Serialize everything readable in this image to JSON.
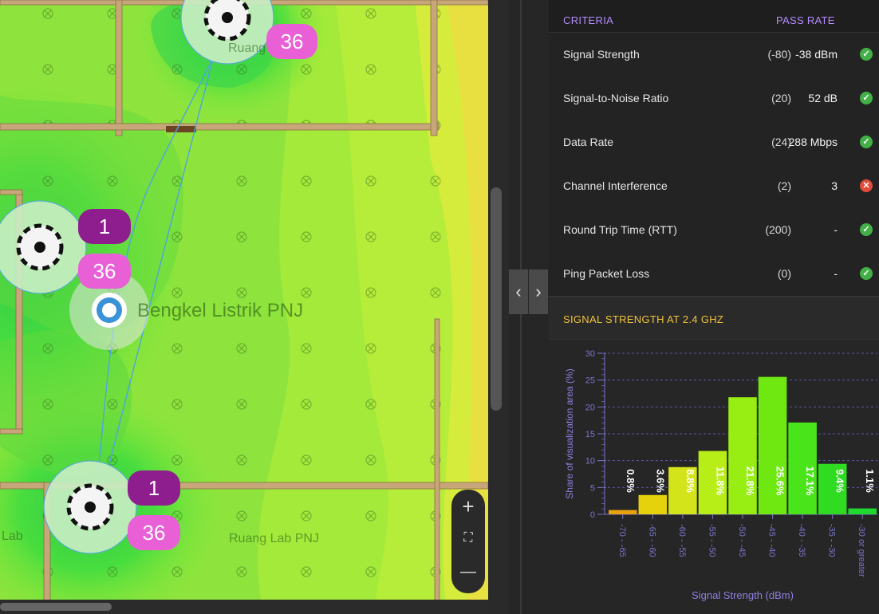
{
  "map": {
    "room_labels": [
      "Ruang Kelas",
      "Bengkel Listrik PNJ",
      "Lab",
      "Ruang Lab PNJ"
    ],
    "access_points": [
      {
        "channel_top": "1",
        "channel_bottom": "36"
      },
      {
        "channel_top": "1",
        "channel_bottom": "36"
      },
      {
        "channel_top": "",
        "channel_bottom": "36"
      }
    ],
    "zoom": {
      "in": "+",
      "fit": "⛶",
      "out": "—"
    }
  },
  "nav": {
    "collapse_left": "‹",
    "expand_right": "›"
  },
  "criteria": {
    "header_label": "CRITERIA",
    "header_pass": "PASS RATE",
    "rows": [
      {
        "label": "Signal Strength",
        "threshold": "(-80)",
        "value": "-38 dBm",
        "status": "pass"
      },
      {
        "label": "Signal-to-Noise Ratio",
        "threshold": "(20)",
        "value": "52 dB",
        "status": "pass"
      },
      {
        "label": "Data Rate",
        "threshold": "(24)",
        "value": "288 Mbps",
        "status": "pass"
      },
      {
        "label": "Channel Interference",
        "threshold": "(2)",
        "value": "3",
        "status": "fail"
      },
      {
        "label": "Round Trip Time (RTT)",
        "threshold": "(200)",
        "value": "-",
        "status": "pass"
      },
      {
        "label": "Ping Packet Loss",
        "threshold": "(0)",
        "value": "-",
        "status": "pass"
      }
    ]
  },
  "status_icons": {
    "pass": "✓",
    "fail": "✕"
  },
  "signal_section": {
    "title": "SIGNAL STRENGTH AT 2.4 GHZ"
  },
  "chart_data": {
    "type": "bar",
    "title": "",
    "xlabel": "Signal Strength (dBm)",
    "ylabel": "Share of visualization area (%)",
    "ylim": [
      0,
      30
    ],
    "yticks": [
      0,
      5,
      10,
      15,
      20,
      25,
      30
    ],
    "categories": [
      "-70 - -65",
      "-65 - -60",
      "-60 - -55",
      "-55 - -50",
      "-50 - -45",
      "-45 - -40",
      "-40 - -35",
      "-35 - -30",
      "-30 or greater"
    ],
    "values": [
      0.8,
      3.6,
      8.8,
      11.8,
      21.8,
      25.6,
      17.1,
      9.4,
      1.1
    ],
    "data_labels": [
      "0.8%",
      "3.6%",
      "8.8%",
      "11.8%",
      "21.8%",
      "25.6%",
      "17.1%",
      "9.4%",
      "1.1%"
    ],
    "colors": [
      "#e8a10f",
      "#e6d20c",
      "#d3e41a",
      "#b8ee18",
      "#98ee12",
      "#6fe812",
      "#4ae41a",
      "#2fdc22",
      "#1fd830"
    ],
    "grid": true
  }
}
